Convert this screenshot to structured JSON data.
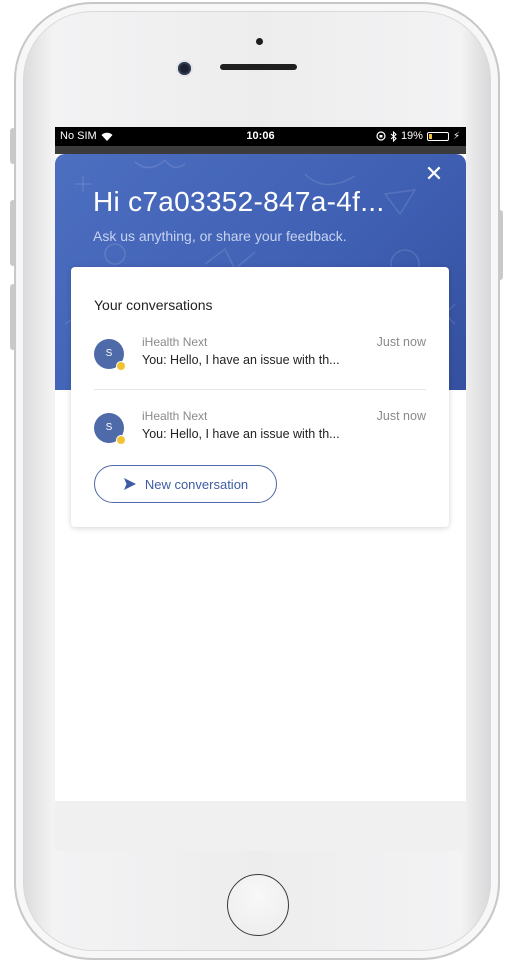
{
  "status_bar": {
    "carrier": "No SIM",
    "time": "10:06",
    "battery": "19%",
    "battery_level": 0.19,
    "icons": [
      "wifi-icon",
      "orientation-lock-icon",
      "bluetooth-icon",
      "battery-icon",
      "charging-icon"
    ]
  },
  "header": {
    "title": "Hi c7a03352-847a-4f...",
    "subtitle": "Ask us anything, or share your feedback.",
    "close_icon": "✕"
  },
  "conversations": {
    "heading": "Your conversations",
    "items": [
      {
        "avatar_initial": "S",
        "sender": "iHealth Next",
        "time": "Just now",
        "preview": "You: Hello, I have an issue with th..."
      },
      {
        "avatar_initial": "S",
        "sender": "iHealth Next",
        "time": "Just now",
        "preview": "You: Hello, I have an issue with th..."
      }
    ],
    "new_conversation_label": "New conversation"
  },
  "colors": {
    "brand": "#4d6fc0",
    "presence": "#f1c232",
    "text_primary": "#222222",
    "text_muted": "#8a8a8a"
  }
}
